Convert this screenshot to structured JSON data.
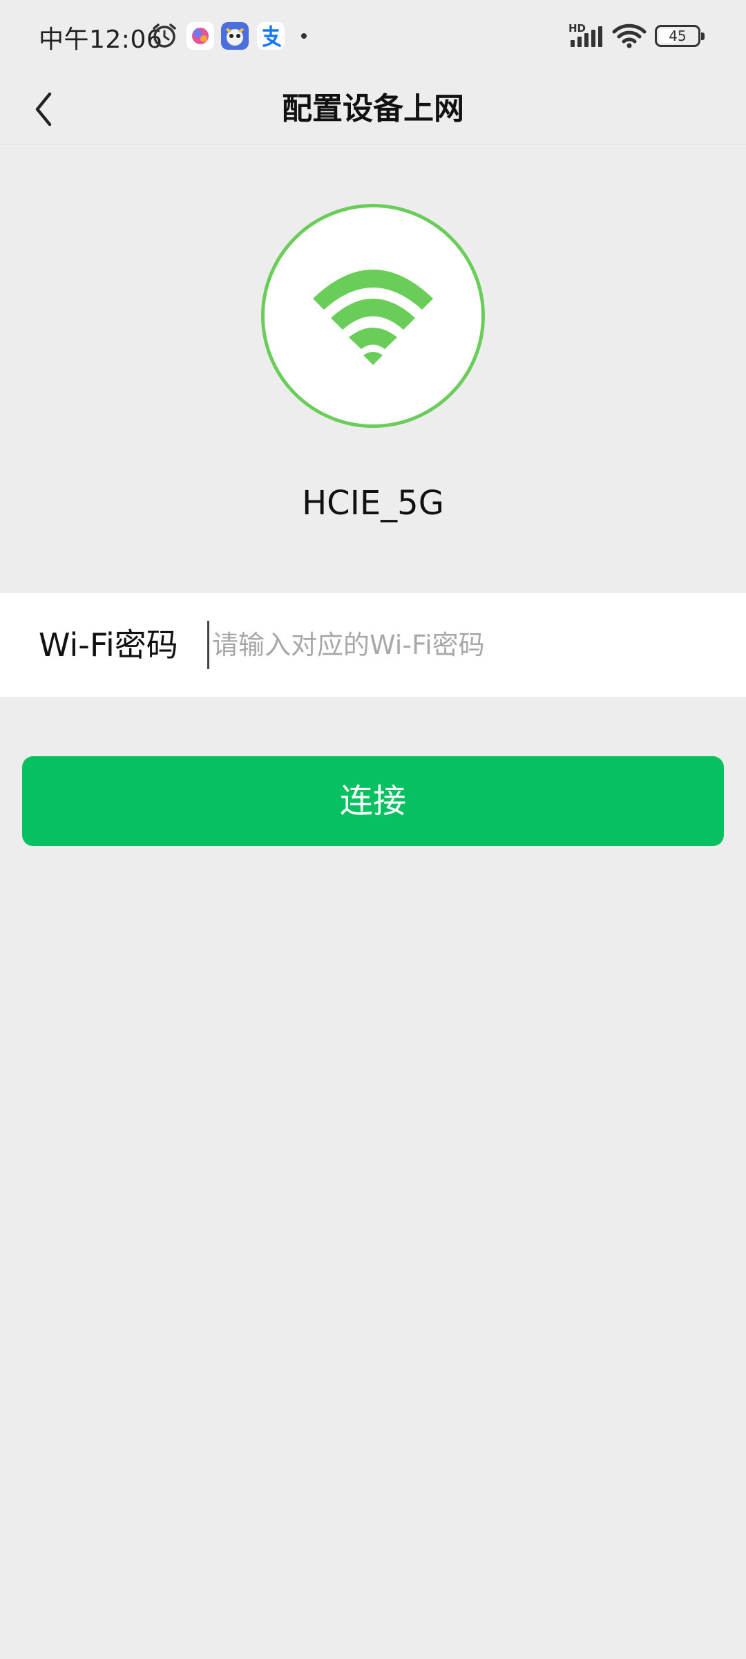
{
  "status_bar": {
    "time": "中午12:06",
    "network_type": "HD",
    "battery_level": "45",
    "icons": [
      "alarm-icon",
      "app-icon",
      "game-app-icon",
      "alipay-icon",
      "notification-dot",
      "signal-icon",
      "wifi-icon",
      "battery-icon"
    ]
  },
  "nav": {
    "title": "配置设备上网",
    "back_icon": "chevron-left-icon"
  },
  "wifi": {
    "icon": "wifi-icon",
    "ssid": "HCIE_5G",
    "accent_color": "#6acd59"
  },
  "password": {
    "label": "Wi-Fi密码",
    "value": "",
    "placeholder": "请输入对应的Wi-Fi密码"
  },
  "connect": {
    "label": "连接",
    "color": "#07c160"
  }
}
